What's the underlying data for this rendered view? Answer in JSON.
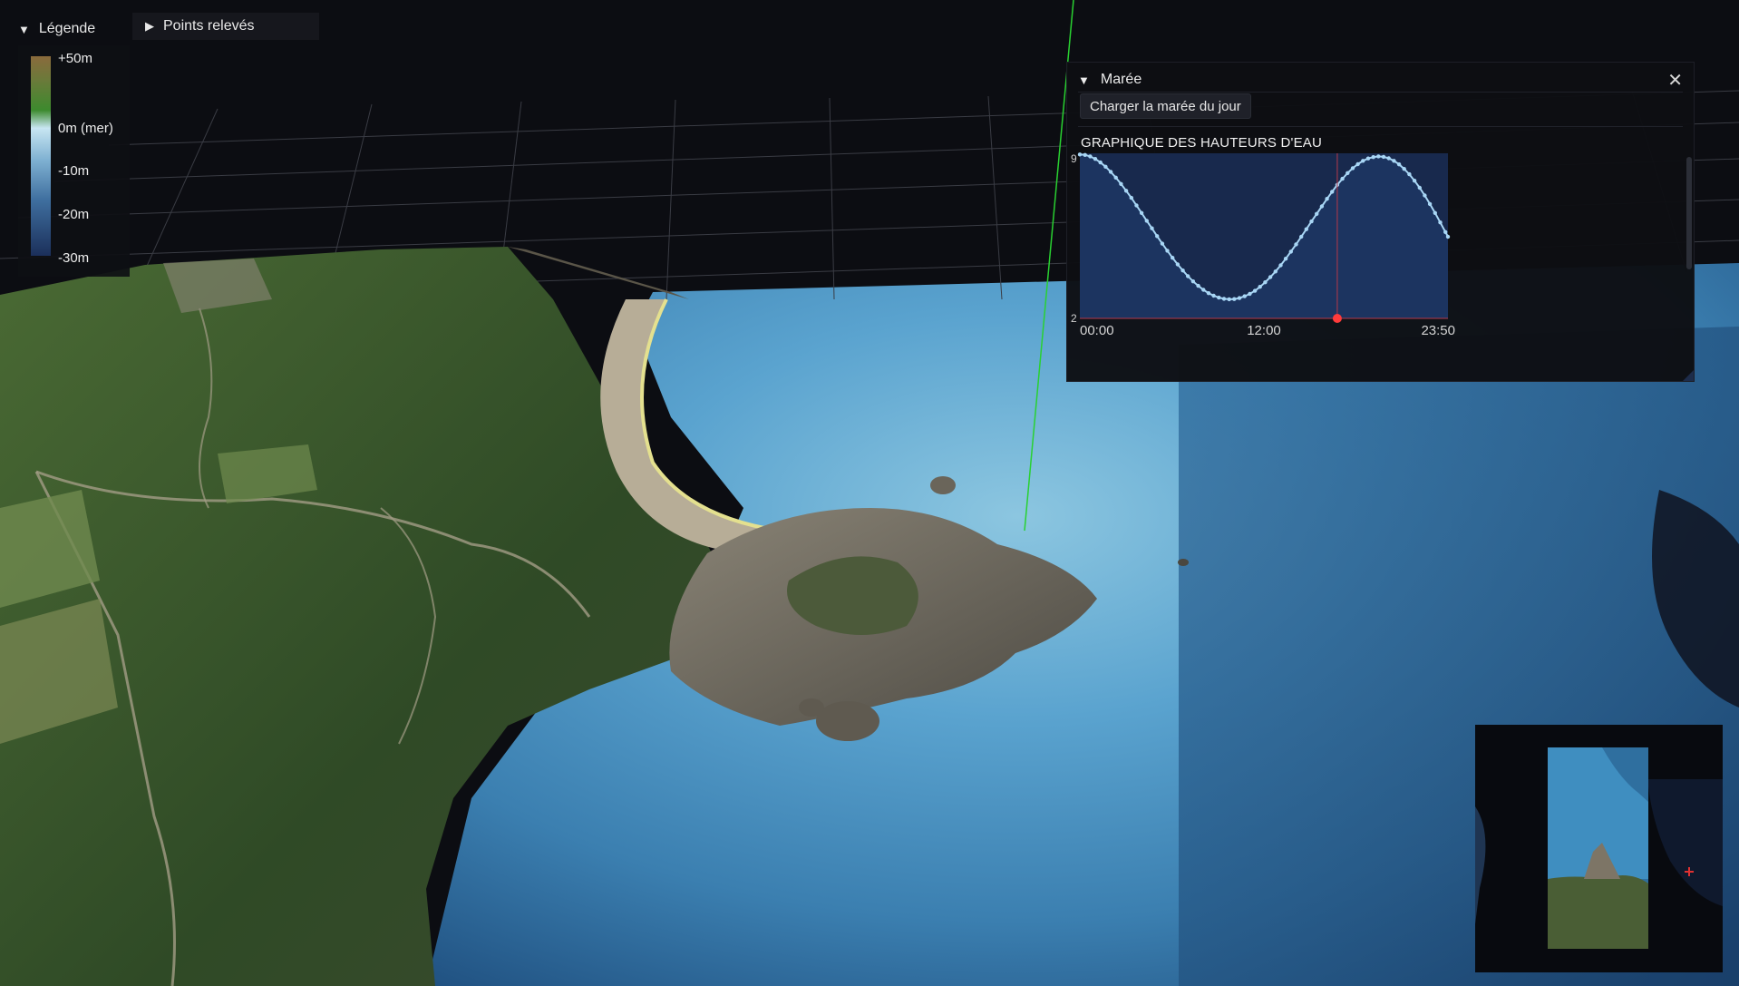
{
  "legend": {
    "title": "Légende",
    "labels": [
      "+50m",
      "0m (mer)",
      "-10m",
      "-20m",
      "-30m"
    ]
  },
  "points_panel": {
    "title": "Points relevés"
  },
  "tide_panel": {
    "title": "Marée",
    "load_button": "Charger la marée du jour",
    "chart_title": "GRAPHIQUE DES HAUTEURS D'EAU",
    "y_top_label": "9",
    "y_bottom_label": "2",
    "colors": {
      "line": "#a8d6f5",
      "current": "#ff3b3b",
      "fill": "#18294d"
    }
  },
  "chart_data": {
    "type": "line",
    "x_tick_labels": [
      "00:00",
      "12:00",
      "23:50"
    ],
    "xlim_minutes": [
      0,
      1430
    ],
    "ylim": [
      2,
      9
    ],
    "series": [
      {
        "x_minutes": [
          0,
          20,
          40,
          60,
          80,
          100,
          120,
          140,
          160,
          180,
          200,
          220,
          240,
          260,
          280,
          300,
          320,
          340,
          360,
          380,
          400,
          420,
          440,
          460,
          480,
          500,
          520,
          540,
          560,
          580,
          600,
          620,
          640,
          660,
          680,
          700,
          720,
          740,
          760,
          780,
          800,
          820,
          840,
          860,
          880,
          900,
          920,
          940,
          960,
          980,
          1000,
          1020,
          1040,
          1060,
          1080,
          1100,
          1120,
          1140,
          1160,
          1180,
          1200,
          1220,
          1240,
          1260,
          1280,
          1300,
          1320,
          1340,
          1360,
          1380,
          1400,
          1420,
          1430
        ],
        "values": [
          8.95,
          8.93,
          8.87,
          8.76,
          8.61,
          8.43,
          8.21,
          7.97,
          7.7,
          7.41,
          7.11,
          6.79,
          6.47,
          6.14,
          5.82,
          5.49,
          5.17,
          4.87,
          4.57,
          4.29,
          4.03,
          3.79,
          3.57,
          3.38,
          3.21,
          3.07,
          2.96,
          2.88,
          2.83,
          2.81,
          2.82,
          2.86,
          2.94,
          3.04,
          3.17,
          3.34,
          3.53,
          3.75,
          3.99,
          4.25,
          4.53,
          4.83,
          5.14,
          5.46,
          5.78,
          6.11,
          6.43,
          6.75,
          7.07,
          7.37,
          7.66,
          7.92,
          8.16,
          8.37,
          8.54,
          8.68,
          8.78,
          8.84,
          8.87,
          8.85,
          8.79,
          8.68,
          8.53,
          8.34,
          8.11,
          7.84,
          7.54,
          7.21,
          6.85,
          6.47,
          6.07,
          5.66,
          5.46
        ]
      }
    ],
    "current_point": {
      "x_minutes": 1000,
      "value": 2.0
    }
  },
  "scene": {
    "colors": {
      "sky": "#0c0d12",
      "grid": "#3a3c44",
      "sea": "#4f97c4",
      "land": "#3a5a2c",
      "sand": "#b7ad97",
      "rock": "#6f6a5f",
      "axis": "#29d131"
    }
  },
  "minimap": {
    "marker_color": "#e03131"
  }
}
